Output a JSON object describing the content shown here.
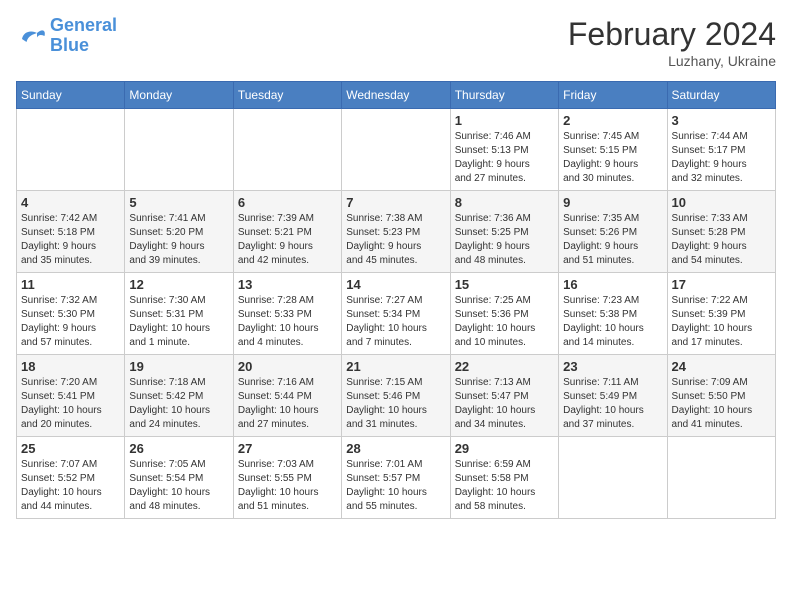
{
  "header": {
    "logo_line1": "General",
    "logo_line2": "Blue",
    "month_year": "February 2024",
    "location": "Luzhany, Ukraine"
  },
  "weekdays": [
    "Sunday",
    "Monday",
    "Tuesday",
    "Wednesday",
    "Thursday",
    "Friday",
    "Saturday"
  ],
  "weeks": [
    [
      {
        "day": "",
        "info": ""
      },
      {
        "day": "",
        "info": ""
      },
      {
        "day": "",
        "info": ""
      },
      {
        "day": "",
        "info": ""
      },
      {
        "day": "1",
        "info": "Sunrise: 7:46 AM\nSunset: 5:13 PM\nDaylight: 9 hours\nand 27 minutes."
      },
      {
        "day": "2",
        "info": "Sunrise: 7:45 AM\nSunset: 5:15 PM\nDaylight: 9 hours\nand 30 minutes."
      },
      {
        "day": "3",
        "info": "Sunrise: 7:44 AM\nSunset: 5:17 PM\nDaylight: 9 hours\nand 32 minutes."
      }
    ],
    [
      {
        "day": "4",
        "info": "Sunrise: 7:42 AM\nSunset: 5:18 PM\nDaylight: 9 hours\nand 35 minutes."
      },
      {
        "day": "5",
        "info": "Sunrise: 7:41 AM\nSunset: 5:20 PM\nDaylight: 9 hours\nand 39 minutes."
      },
      {
        "day": "6",
        "info": "Sunrise: 7:39 AM\nSunset: 5:21 PM\nDaylight: 9 hours\nand 42 minutes."
      },
      {
        "day": "7",
        "info": "Sunrise: 7:38 AM\nSunset: 5:23 PM\nDaylight: 9 hours\nand 45 minutes."
      },
      {
        "day": "8",
        "info": "Sunrise: 7:36 AM\nSunset: 5:25 PM\nDaylight: 9 hours\nand 48 minutes."
      },
      {
        "day": "9",
        "info": "Sunrise: 7:35 AM\nSunset: 5:26 PM\nDaylight: 9 hours\nand 51 minutes."
      },
      {
        "day": "10",
        "info": "Sunrise: 7:33 AM\nSunset: 5:28 PM\nDaylight: 9 hours\nand 54 minutes."
      }
    ],
    [
      {
        "day": "11",
        "info": "Sunrise: 7:32 AM\nSunset: 5:30 PM\nDaylight: 9 hours\nand 57 minutes."
      },
      {
        "day": "12",
        "info": "Sunrise: 7:30 AM\nSunset: 5:31 PM\nDaylight: 10 hours\nand 1 minute."
      },
      {
        "day": "13",
        "info": "Sunrise: 7:28 AM\nSunset: 5:33 PM\nDaylight: 10 hours\nand 4 minutes."
      },
      {
        "day": "14",
        "info": "Sunrise: 7:27 AM\nSunset: 5:34 PM\nDaylight: 10 hours\nand 7 minutes."
      },
      {
        "day": "15",
        "info": "Sunrise: 7:25 AM\nSunset: 5:36 PM\nDaylight: 10 hours\nand 10 minutes."
      },
      {
        "day": "16",
        "info": "Sunrise: 7:23 AM\nSunset: 5:38 PM\nDaylight: 10 hours\nand 14 minutes."
      },
      {
        "day": "17",
        "info": "Sunrise: 7:22 AM\nSunset: 5:39 PM\nDaylight: 10 hours\nand 17 minutes."
      }
    ],
    [
      {
        "day": "18",
        "info": "Sunrise: 7:20 AM\nSunset: 5:41 PM\nDaylight: 10 hours\nand 20 minutes."
      },
      {
        "day": "19",
        "info": "Sunrise: 7:18 AM\nSunset: 5:42 PM\nDaylight: 10 hours\nand 24 minutes."
      },
      {
        "day": "20",
        "info": "Sunrise: 7:16 AM\nSunset: 5:44 PM\nDaylight: 10 hours\nand 27 minutes."
      },
      {
        "day": "21",
        "info": "Sunrise: 7:15 AM\nSunset: 5:46 PM\nDaylight: 10 hours\nand 31 minutes."
      },
      {
        "day": "22",
        "info": "Sunrise: 7:13 AM\nSunset: 5:47 PM\nDaylight: 10 hours\nand 34 minutes."
      },
      {
        "day": "23",
        "info": "Sunrise: 7:11 AM\nSunset: 5:49 PM\nDaylight: 10 hours\nand 37 minutes."
      },
      {
        "day": "24",
        "info": "Sunrise: 7:09 AM\nSunset: 5:50 PM\nDaylight: 10 hours\nand 41 minutes."
      }
    ],
    [
      {
        "day": "25",
        "info": "Sunrise: 7:07 AM\nSunset: 5:52 PM\nDaylight: 10 hours\nand 44 minutes."
      },
      {
        "day": "26",
        "info": "Sunrise: 7:05 AM\nSunset: 5:54 PM\nDaylight: 10 hours\nand 48 minutes."
      },
      {
        "day": "27",
        "info": "Sunrise: 7:03 AM\nSunset: 5:55 PM\nDaylight: 10 hours\nand 51 minutes."
      },
      {
        "day": "28",
        "info": "Sunrise: 7:01 AM\nSunset: 5:57 PM\nDaylight: 10 hours\nand 55 minutes."
      },
      {
        "day": "29",
        "info": "Sunrise: 6:59 AM\nSunset: 5:58 PM\nDaylight: 10 hours\nand 58 minutes."
      },
      {
        "day": "",
        "info": ""
      },
      {
        "day": "",
        "info": ""
      }
    ]
  ]
}
